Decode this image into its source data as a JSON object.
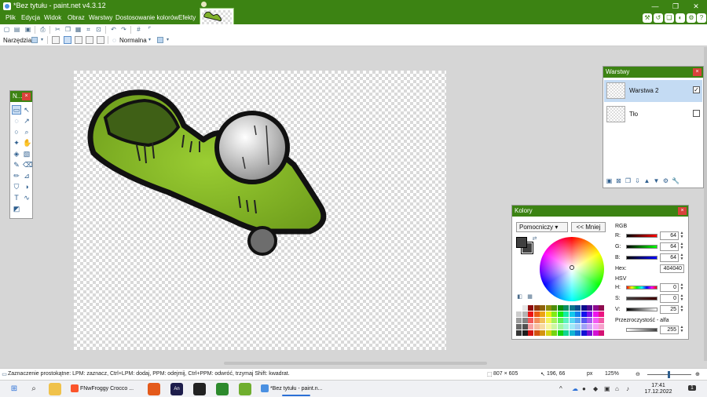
{
  "window": {
    "title": "*Bez tytułu - paint.net v4.3.12",
    "minimize": "—",
    "maximize": "❐",
    "close": "✕"
  },
  "menu": {
    "items": [
      "Plik",
      "Edycja",
      "Widok",
      "Obraz",
      "Warstwy",
      "Dostosowanie kolorów",
      "Efekty"
    ]
  },
  "toolbar": {
    "tool_label": "Narzędzia:",
    "quality": "Normalna"
  },
  "tools_window": {
    "title": "N..."
  },
  "layers_window": {
    "title": "Warstwy",
    "layers": [
      {
        "name": "Warstwa 2",
        "visible": true,
        "selected": true
      },
      {
        "name": "Tło",
        "visible": false,
        "selected": false
      }
    ]
  },
  "colors_window": {
    "title": "Kolory",
    "mode": "Pomocniczy",
    "less_button": "<< Mniej",
    "rgb_label": "RGB",
    "r_label": "R:",
    "g_label": "G:",
    "b_label": "B:",
    "r": "64",
    "g": "64",
    "b": "64",
    "hex_label": "Hex:",
    "hex": "404040",
    "hsv_label": "HSV",
    "h_label": "H:",
    "s_label": "S:",
    "v_label": "V:",
    "h": "0",
    "s": "0",
    "v": "25",
    "alpha_label": "Przezroczystość - alfa",
    "alpha": "255",
    "primary_color": "#404040",
    "secondary_color": "#404040"
  },
  "status": {
    "hint": "Zaznaczenie prostokątne: LPM: zaznacz, Ctrl+LPM: dodaj, PPM: odejmij, Ctrl+PPM: odwróć, trzymaj Shift: kwadrat.",
    "image_size": "807 × 605",
    "cursor": "196, 66",
    "unit": "px",
    "zoom": "125%"
  },
  "taskbar": {
    "items": [
      {
        "label": "FNwFroggy Crocco ..."
      },
      {
        "label": "*Bez tytułu - paint.n..."
      }
    ],
    "time": "17:41",
    "date": "17.12.2022",
    "notifications": "1"
  },
  "colors": {
    "accent": "#3c8313",
    "selection": "#c4dbf3"
  }
}
